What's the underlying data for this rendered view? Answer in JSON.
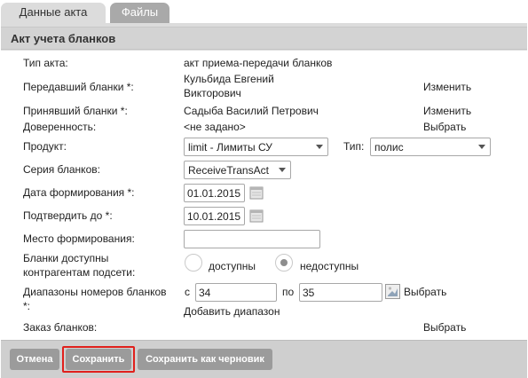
{
  "tabs": [
    {
      "label": "Данные акта"
    },
    {
      "label": "Файлы"
    }
  ],
  "header": {
    "title": "Акт учета бланков"
  },
  "form": {
    "act_type": {
      "label": "Тип акта:",
      "value": "акт приема-передачи бланков"
    },
    "sender": {
      "label": "Передавший бланки *:",
      "value_line1": "Кульбида Евгений",
      "value_line2": "Викторович",
      "action": "Изменить"
    },
    "receiver": {
      "label": "Принявший бланки *:",
      "value": "Садыба Василий Петрович",
      "action": "Изменить"
    },
    "proxy": {
      "label": "Доверенность:",
      "value": "<не задано>",
      "action": "Выбрать"
    },
    "product": {
      "label": "Продукт:",
      "selected": "limit - Лимиты СУ"
    },
    "type": {
      "label": "Тип:",
      "selected": "полис"
    },
    "series": {
      "label": "Серия бланков:",
      "selected": "ReceiveTransAct"
    },
    "created_date": {
      "label": "Дата формирования *:",
      "value": "01.01.2015"
    },
    "confirm_until": {
      "label": "Подтвердить до *:",
      "value": "10.01.2015"
    },
    "place": {
      "label": "Место формирования:",
      "value": ""
    },
    "availability": {
      "label_line1": "Бланки доступны",
      "label_line2": "контрагентам подсети:",
      "options": [
        "доступны",
        "недоступны"
      ],
      "selected": "недоступны"
    },
    "ranges": {
      "label_line1": "Диапазоны номеров бланков",
      "label_line2": "*:",
      "from_label": "с",
      "from_value": "34",
      "to_label": "по",
      "to_value": "35",
      "action": "Выбрать",
      "add_action": "Добавить диапазон"
    },
    "order": {
      "label": "Заказ бланков:",
      "action": "Выбрать"
    }
  },
  "buttons": {
    "cancel": "Отмена",
    "save": "Сохранить",
    "save_draft": "Сохранить как черновик"
  },
  "colors": {
    "highlight": "#e0201c",
    "button": "#9b9b9b",
    "panel": "#dcdcdc"
  }
}
